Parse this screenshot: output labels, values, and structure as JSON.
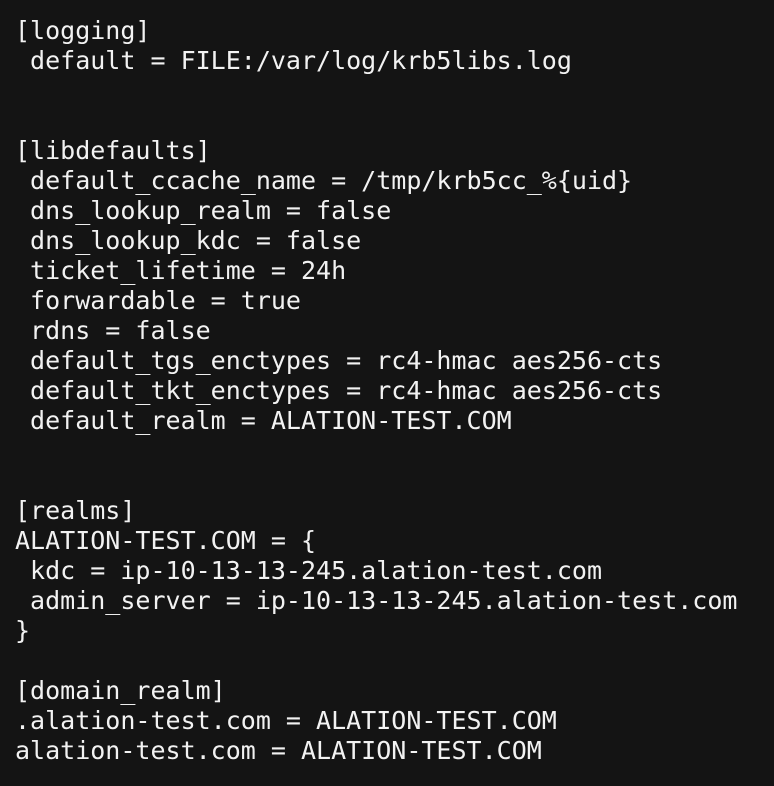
{
  "terminal": {
    "lines": [
      "[logging]",
      " default = FILE:/var/log/krb5libs.log",
      "",
      "",
      "[libdefaults]",
      " default_ccache_name = /tmp/krb5cc_%{uid}",
      " dns_lookup_realm = false",
      " dns_lookup_kdc = false",
      " ticket_lifetime = 24h",
      " forwardable = true",
      " rdns = false",
      " default_tgs_enctypes = rc4-hmac aes256-cts",
      " default_tkt_enctypes = rc4-hmac aes256-cts",
      " default_realm = ALATION-TEST.COM",
      "",
      "",
      "[realms]",
      "ALATION-TEST.COM = {",
      " kdc = ip-10-13-13-245.alation-test.com",
      " admin_server = ip-10-13-13-245.alation-test.com",
      "}",
      "",
      "[domain_realm]",
      ".alation-test.com = ALATION-TEST.COM",
      "alation-test.com = ALATION-TEST.COM"
    ]
  },
  "colors": {
    "background": "#141414",
    "text": "#f2f2f2"
  }
}
